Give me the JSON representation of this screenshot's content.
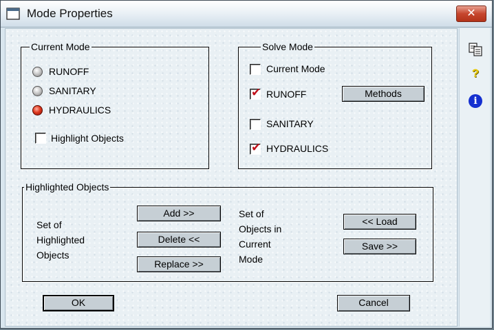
{
  "window": {
    "title": "Mode Properties",
    "close_glyph": "✕"
  },
  "side_toolbar": {
    "icons": [
      "copy-icon",
      "help-icon",
      "info-icon"
    ],
    "help_glyph": "?",
    "info_glyph": "i"
  },
  "current_mode": {
    "legend": "Current Mode",
    "options": [
      {
        "label": "RUNOFF",
        "selected": false
      },
      {
        "label": "SANITARY",
        "selected": false
      },
      {
        "label": "HYDRAULICS",
        "selected": true
      }
    ],
    "highlight_objects": {
      "label": "Highlight Objects",
      "checked": false
    }
  },
  "solve_mode": {
    "legend": "Solve Mode",
    "options": [
      {
        "label": "Current Mode",
        "checked": false
      },
      {
        "label": "RUNOFF",
        "checked": true
      },
      {
        "label": "SANITARY",
        "checked": false
      },
      {
        "label": "HYDRAULICS",
        "checked": true
      }
    ],
    "methods_button": "Methods",
    "check_glyph": "✔"
  },
  "highlighted_objects": {
    "legend": "Highlighted Objects",
    "left_text": [
      "Set of",
      "Highlighted",
      "Objects"
    ],
    "add_button": "Add >>",
    "delete_button": "Delete <<",
    "replace_button": "Replace >>",
    "right_text": [
      "Set of",
      "Objects in",
      "Current",
      "Mode"
    ],
    "load_button": "<< Load",
    "save_button": "Save >>"
  },
  "footer": {
    "ok_button": "OK",
    "cancel_button": "Cancel"
  },
  "colors": {
    "selected_radio": "#e03a20",
    "check_mark": "#c0101a",
    "info_icon": "#1530d0",
    "help_icon": "#e8c800",
    "close_button": "#c6462e"
  }
}
